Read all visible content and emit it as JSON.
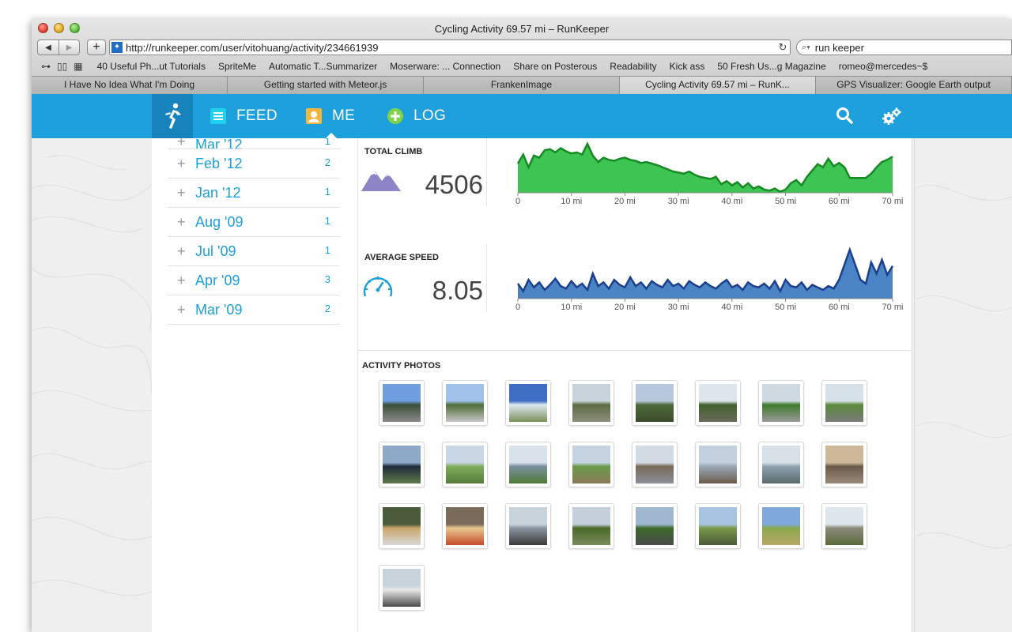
{
  "window": {
    "title": "Cycling Activity 69.57 mi – RunKeeper"
  },
  "toolbar": {
    "url": "http://runkeeper.com/user/vitohuang/activity/234661939",
    "search_value": "run keeper"
  },
  "bookmarks": [
    "40 Useful Ph...ut Tutorials",
    "SpriteMe",
    "Automatic T...Summarizer",
    "Moserware: ... Connection",
    "Share on Posterous",
    "Readability",
    "Kick ass",
    "50 Fresh Us...g Magazine",
    "romeo@mercedes~$"
  ],
  "tabs": [
    {
      "label": "I Have No Idea What I'm Doing",
      "active": false
    },
    {
      "label": "Getting started with Meteor.js",
      "active": false
    },
    {
      "label": "FrankenImage",
      "active": false
    },
    {
      "label": "Cycling Activity 69.57 mi – RunK...",
      "active": true
    },
    {
      "label": "GPS Visualizer: Google Earth output",
      "active": false
    }
  ],
  "site_nav": {
    "feed": "FEED",
    "me": "ME",
    "log": "LOG"
  },
  "sidebar": {
    "partial": {
      "label": "Mar '12",
      "count": "1"
    },
    "months": [
      {
        "label": "Feb '12",
        "count": "2"
      },
      {
        "label": "Jan '12",
        "count": "1"
      },
      {
        "label": "Aug '09",
        "count": "1"
      },
      {
        "label": "Jul '09",
        "count": "1"
      },
      {
        "label": "Apr '09",
        "count": "3"
      },
      {
        "label": "Mar '09",
        "count": "2"
      }
    ]
  },
  "metrics": {
    "climb": {
      "title": "TOTAL CLIMB",
      "value": "4506"
    },
    "speed": {
      "title": "AVERAGE SPEED",
      "value": "8.05"
    }
  },
  "photos": {
    "title": "ACTIVITY PHOTOS",
    "count": 25
  },
  "colors": {
    "brand_blue": "#1ea0dc",
    "climb_green": "#3dc453",
    "climb_line": "#168a22",
    "speed_fill": "#4a84c4",
    "speed_line": "#1b3f8f"
  },
  "chart_data": [
    {
      "type": "area",
      "title": "TOTAL CLIMB",
      "x_tick_labels": [
        "0",
        "10 mi",
        "20 mi",
        "30 mi",
        "40 mi",
        "50 mi",
        "60 mi",
        "70 mi"
      ],
      "xlim": [
        0,
        70
      ],
      "x": [
        0,
        1,
        2,
        3,
        4,
        5,
        6,
        7,
        8,
        9,
        10,
        11,
        12,
        13,
        14,
        15,
        16,
        17,
        18,
        19,
        20,
        21,
        22,
        23,
        24,
        25,
        26,
        27,
        28,
        29,
        30,
        31,
        32,
        33,
        34,
        35,
        36,
        37,
        38,
        39,
        40,
        41,
        42,
        43,
        44,
        45,
        46,
        47,
        48,
        49,
        50,
        51,
        52,
        53,
        54,
        55,
        56,
        57,
        58,
        59,
        60,
        61,
        62,
        63,
        64,
        65,
        66,
        67,
        68,
        69,
        70
      ],
      "y": [
        55,
        72,
        48,
        70,
        66,
        80,
        82,
        76,
        84,
        78,
        74,
        76,
        72,
        92,
        70,
        58,
        66,
        62,
        60,
        64,
        66,
        62,
        60,
        56,
        58,
        55,
        52,
        48,
        44,
        40,
        38,
        36,
        40,
        34,
        30,
        28,
        26,
        30,
        16,
        22,
        14,
        20,
        10,
        18,
        8,
        12,
        6,
        4,
        8,
        2,
        6,
        18,
        24,
        14,
        30,
        42,
        54,
        48,
        64,
        50,
        56,
        48,
        28,
        28,
        28,
        28,
        36,
        48,
        58,
        62,
        68
      ]
    },
    {
      "type": "area",
      "title": "AVERAGE SPEED",
      "x_tick_labels": [
        "0",
        "10 mi",
        "20 mi",
        "30 mi",
        "40 mi",
        "50 mi",
        "60 mi",
        "70 mi"
      ],
      "xlim": [
        0,
        70
      ],
      "x": [
        0,
        1,
        2,
        3,
        4,
        5,
        6,
        7,
        8,
        9,
        10,
        11,
        12,
        13,
        14,
        15,
        16,
        17,
        18,
        19,
        20,
        21,
        22,
        23,
        24,
        25,
        26,
        27,
        28,
        29,
        30,
        31,
        32,
        33,
        34,
        35,
        36,
        37,
        38,
        39,
        40,
        41,
        42,
        43,
        44,
        45,
        46,
        47,
        48,
        49,
        50,
        51,
        52,
        53,
        54,
        55,
        56,
        57,
        58,
        59,
        60,
        61,
        62,
        63,
        64,
        65,
        66,
        67,
        68,
        69,
        70
      ],
      "y": [
        24,
        12,
        30,
        18,
        26,
        14,
        22,
        32,
        20,
        16,
        28,
        18,
        24,
        14,
        40,
        20,
        26,
        16,
        30,
        22,
        18,
        34,
        20,
        26,
        16,
        28,
        22,
        18,
        30,
        20,
        24,
        16,
        28,
        22,
        18,
        26,
        20,
        16,
        24,
        30,
        18,
        22,
        14,
        26,
        20,
        18,
        24,
        16,
        28,
        12,
        30,
        20,
        18,
        26,
        14,
        22,
        18,
        14,
        20,
        16,
        30,
        54,
        78,
        54,
        30,
        24,
        58,
        40,
        62,
        38,
        52
      ]
    }
  ]
}
